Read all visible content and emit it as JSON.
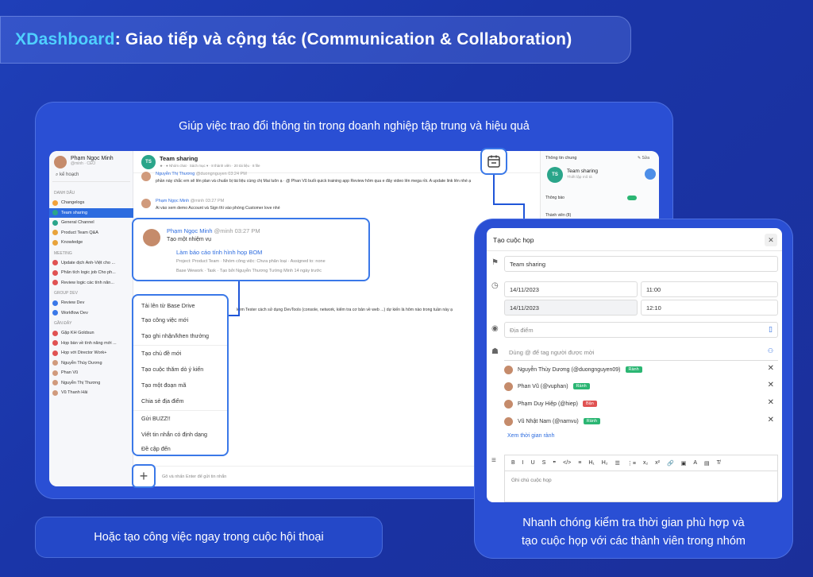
{
  "header": {
    "brand": "XDashboard",
    "title_rest": ": Giao tiếp và cộng tác (Communication & Collaboration)"
  },
  "captions": {
    "top": "Giúp việc trao đổi thông tin trong doanh nghiệp tập trung và hiệu quả",
    "bottom_left": "Hoặc tạo công việc ngay trong cuộc hội thoại",
    "bottom_right_1": "Nhanh chóng kiểm tra thời gian phù hợp và",
    "bottom_right_2": "tạo cuộc họp với các thành viên trong nhóm"
  },
  "sidebar": {
    "user_name": "Phạm Ngọc Minh",
    "user_sub": "@minh · CEO",
    "search_value": "kế hoạch",
    "groups": [
      {
        "label": "DANH DẤU",
        "items": [
          {
            "label": "Changelogs",
            "color": "#f2a23a"
          },
          {
            "label": "Team sharing",
            "color": "#2aa58a",
            "active": true
          },
          {
            "label": "General Channel",
            "color": "#2aa58a"
          },
          {
            "label": "Product Team Q&A",
            "color": "#e8a33a"
          },
          {
            "label": "Knowledge",
            "color": "#e8a33a"
          }
        ]
      },
      {
        "label": "MEETING",
        "items": [
          {
            "label": "Update dịch Anh-Việt cho ...",
            "color": "#e05252"
          },
          {
            "label": "Phân tích logic job Cho ph...",
            "color": "#e05252"
          },
          {
            "label": "Review logic các tính năn...",
            "color": "#e05252"
          }
        ]
      },
      {
        "label": "GROUP DEV",
        "items": [
          {
            "label": "Review Dev",
            "color": "#3a78e8"
          },
          {
            "label": "Workflow Dev",
            "color": "#3a78e8"
          }
        ]
      },
      {
        "label": "GẦN ĐÂY",
        "items": [
          {
            "label": "Gặp KH Goldsun",
            "color": "#e05252"
          },
          {
            "label": "Họp bàn về tính năng mới ...",
            "color": "#e05252"
          },
          {
            "label": "Họp với Director Work+",
            "color": "#e05252"
          },
          {
            "label": "Nguyễn Thùy Dương",
            "color": "#d09a7c"
          },
          {
            "label": "Phan Vũ",
            "color": "#d09a7c"
          },
          {
            "label": "Nguyễn Thị Thương",
            "color": "#d09a7c"
          },
          {
            "label": "Vũ Thanh Hải",
            "color": "#d09a7c"
          }
        ]
      }
    ]
  },
  "chat": {
    "badge": "TS",
    "title": "Team sharing",
    "meta": "★ · ● Nhóm chat · Sách mục ▾ · 8 thành viên · 20 tài liệu · 8 file",
    "messages": [
      {
        "name": "Nguyễn Thị Thương",
        "handle": "@duongnguyen 03:24 PM",
        "text": "phần này chắc em sẽ lên plan và chuẩn bị tài liệu cùng chị Mai luôn ạ · @ Phan Vũ buổi quick training app Review hôm qua e đây video lên mega rồi. A update link lên nhé ạ"
      },
      {
        "name": "Phạm Ngọc Minh",
        "handle": "@minh 03:27 PM",
        "text": "Ai vào xem demo Account và Sign thì vào phòng Customer love nhé"
      }
    ],
    "bg_text": "kèm Tester cách sử dụng DevTools (console, network, kiểm tra cơ bản về web ...) dự kiến là hôm nào trong tuần này ạ",
    "input_placeholder": "Gõ và nhấn Enter để gửi tin nhắn"
  },
  "info_panel": {
    "title": "Thông tin chung",
    "edit": "✎ Sửa",
    "badge": "TS",
    "name": "Team sharing",
    "sub": "Thiết lập mô tả",
    "notif": "Thông báo",
    "members": "Thành viên (8)"
  },
  "task_card": {
    "name": "Phạm Ngọc Minh",
    "time": "@minh 03:27 PM",
    "action": "Tạo một nhiệm vụ",
    "link": "Làm báo cáo tính hình họp BOM",
    "project_line": "Project: Product Team · Nhóm công việc: Chưa phân loại · Assigned to: none",
    "base_line": "Base Wework · Task · Tạo bởi Nguyễn Thương Tường Minh 14 ngày trước"
  },
  "menu": {
    "items": [
      "Tải lên từ Base Drive",
      "Tạo công việc mới",
      "Tạo ghi nhận/khen thưởng",
      "Tạo chủ đề mới",
      "Tạo cuộc thăm dò ý kiến",
      "Tạo một đoạn mã",
      "Chia sẻ địa điểm",
      "Gửi BUZZ!!",
      "Viết tin nhắn có định dạng",
      "Đề cập đến"
    ]
  },
  "dialog": {
    "title": "Tạo cuộc họp",
    "meeting_name": "Team sharing",
    "start_date": "14/11/2023",
    "start_time": "11:00",
    "end_date": "14/11/2023",
    "end_time": "12:10",
    "location_placeholder": "Địa điểm",
    "tag_placeholder": "Dùng @ để tag người được mời",
    "members": [
      {
        "name": "Nguyễn Thùy Dương (@duongnguyen09)",
        "role": "Rành",
        "color": "#2bb673"
      },
      {
        "name": "Phan Vũ (@vuphan)",
        "role": "Rành",
        "color": "#2bb673"
      },
      {
        "name": "Phạm Duy Hiệp (@hiep)",
        "role": "Bận",
        "color": "#e05252"
      },
      {
        "name": "Vũ Nhật Nam (@namvu)",
        "role": "Rành",
        "color": "#2bb673"
      }
    ],
    "free_time": "Xem thời gian rảnh",
    "toolbar": [
      "B",
      "I",
      "U",
      "S",
      "❞",
      "</>",
      "≡",
      "H₁",
      "H₂",
      "☰",
      "⋮≡",
      "x₂",
      "x²",
      "🔗",
      "▣",
      "A",
      "▤",
      "T̸"
    ],
    "note_placeholder": "Ghi chú cuộc họp"
  }
}
